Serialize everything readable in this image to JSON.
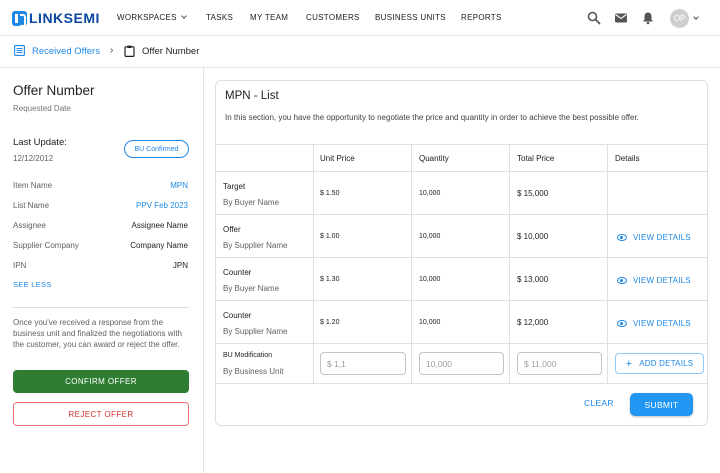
{
  "app": {
    "logo_text": "LINKSEMI"
  },
  "nav": {
    "items": [
      "WORKSPACES",
      "TASKS",
      "MY TEAM",
      "CUSTOMERS",
      "BUSINESS UNITS",
      "REPORTS"
    ],
    "avatar_initials": "OP",
    "icons": [
      "search-icon",
      "mail-icon",
      "bell-icon"
    ]
  },
  "breadcrumb": {
    "parent": "Received Offers",
    "separator": "›",
    "current": "Offer Number"
  },
  "offer": {
    "title": "Offer Number",
    "subtitle": "Requested Date",
    "last_update_label": "Last Update:",
    "last_update_date": "12/12/2012",
    "status_badge": "BU Confirmed",
    "fields": [
      {
        "label": "Item Name",
        "value": "MPN"
      },
      {
        "label": "List Name",
        "value": "PPV Feb 2023"
      },
      {
        "label": "Assignee",
        "value": "Assignee Name"
      },
      {
        "label": "Supplier Company",
        "value": "Company Name"
      },
      {
        "label": "IPN",
        "value": "JPN"
      }
    ],
    "see_less": "SEE LESS",
    "message": "Once you've received a response from the business unit and finalized the negotiations with the customer, you can award or reject the offer.",
    "confirm_label": "CONFIRM OFFER",
    "reject_label": "REJECT OFFER"
  },
  "list": {
    "title": "MPN - List",
    "description": "In this section, you have the opportunity to negotiate the price and quantity in order to achieve the best possible offer.",
    "columns": [
      "Unit Price",
      "Quantity",
      "Total Price",
      "Details"
    ],
    "rows": [
      {
        "title": "Target",
        "sub": "By Buyer Name",
        "unit_price": "$ 1.50",
        "quantity": "10,000",
        "total": "$ 15,000",
        "details": ""
      },
      {
        "title": "Offer",
        "sub": "By Supplier Name",
        "unit_price": "$ 1.00",
        "quantity": "10,000",
        "total": "$ 10,000",
        "details": "VIEW DETAILS"
      },
      {
        "title": "Counter",
        "sub": "By Buyer Name",
        "unit_price": "$ 1.30",
        "quantity": "10,000",
        "total": "$ 13,000",
        "details": "VIEW DETAILS"
      },
      {
        "title": "Counter",
        "sub": "By Supplier Name",
        "unit_price": "$ 1.20",
        "quantity": "10,000",
        "total": "$ 12,000",
        "details": "VIEW DETAILS"
      }
    ],
    "modification": {
      "title": "BU Modification",
      "sub": "By Business Unit",
      "unit_price_placeholder": "$ 1,1",
      "quantity_placeholder": "10,000",
      "total_placeholder": "$ 11,000",
      "add_details": "ADD DETAILS"
    },
    "clear_label": "CLEAR",
    "submit_label": "SUBMIT"
  },
  "colors": {
    "accent": "#1e88e5",
    "confirm": "#2e7d32",
    "reject": "#d32f2f",
    "submit": "#2196f3"
  }
}
